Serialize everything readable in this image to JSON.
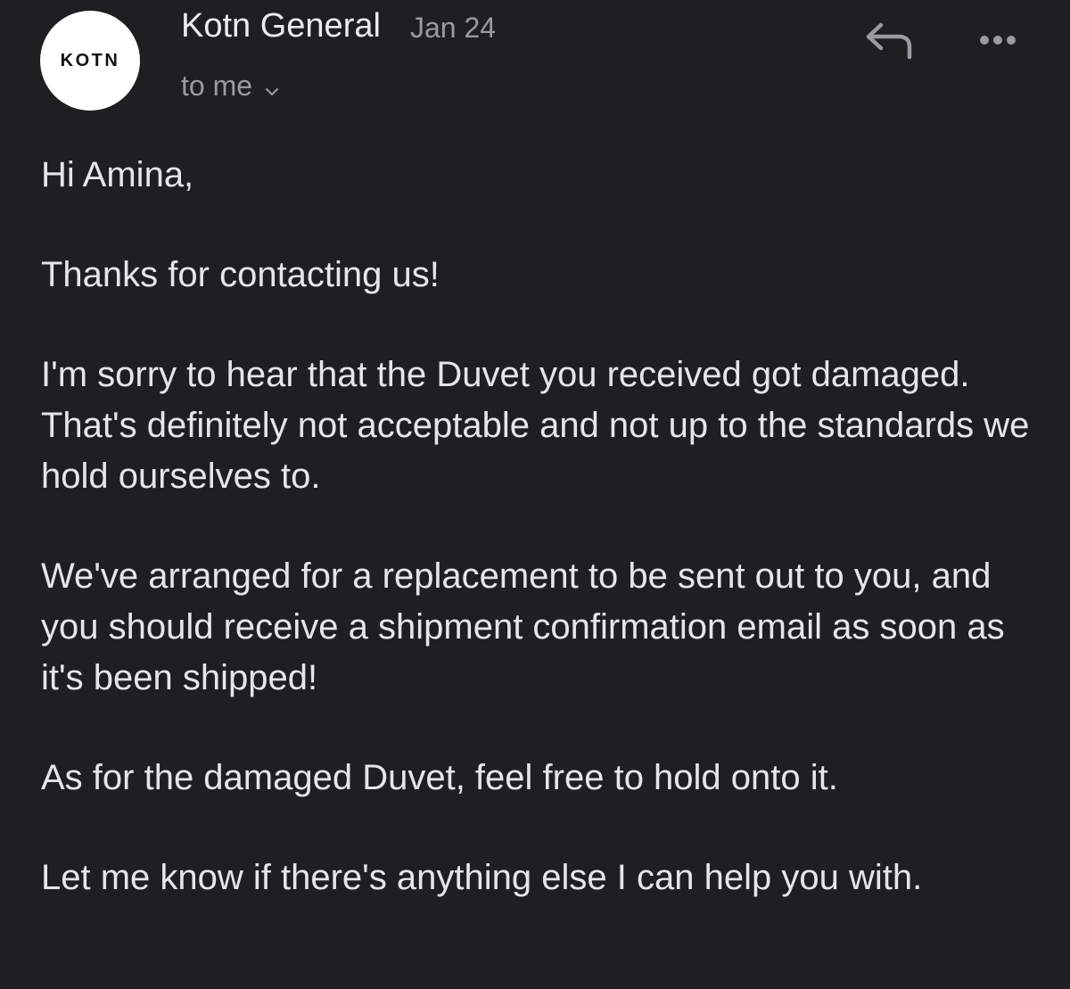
{
  "email": {
    "avatar_text": "KOTN",
    "sender": "Kotn General",
    "date": "Jan 24",
    "recipient": "to me",
    "icons": {
      "reply": "reply-icon",
      "more": "more-horizontal-icon",
      "recipient_toggle": "chevron-down-icon"
    },
    "colors": {
      "background": "#1f1f22",
      "text": "#e6e6e8",
      "secondary_text": "#9a9aa0",
      "avatar_bg": "#ffffff"
    },
    "body": [
      "Hi Amina,",
      "Thanks for contacting us!",
      "I'm sorry to hear that the Duvet you received got damaged. That's definitely not acceptable and not up to the standards we hold ourselves to.",
      "We've arranged for a replacement to be sent out to you, and you should receive a shipment confirmation email as soon as it's been shipped!",
      "As for the damaged Duvet, feel free to hold onto it.",
      "Let me know if there's anything else I can help you with."
    ]
  }
}
